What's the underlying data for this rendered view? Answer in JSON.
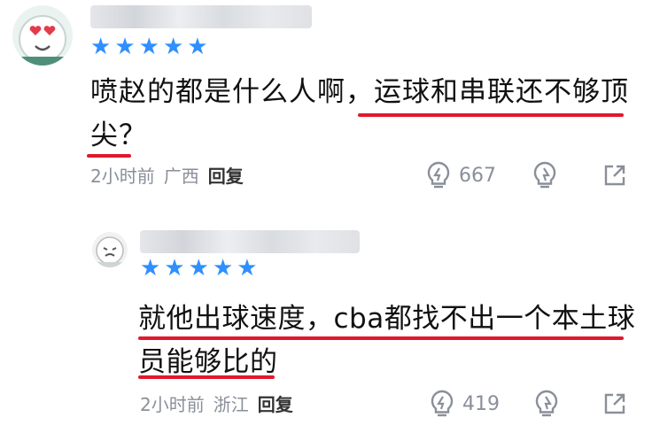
{
  "comments": [
    {
      "rating": 5,
      "text_line1": "喷赵的都是什么人啊，运球和串联还不够顶",
      "text_line2": "尖？",
      "time": "2小时前",
      "location": "广西",
      "reply_label": "回复",
      "likes": "667"
    },
    {
      "rating": 5,
      "text_line1": "就他出球速度，cba都找不出一个本土球",
      "text_line2": "员能够比的",
      "time": "2小时前",
      "location": "浙江",
      "reply_label": "回复",
      "likes": "419"
    }
  ],
  "icons": {
    "star": "star-icon",
    "like": "lightbulb-like-icon",
    "dislike": "lightbulb-dislike-icon",
    "share": "share-icon"
  },
  "colors": {
    "star": "#2f8fff",
    "underline": "#e0192e",
    "meta_text": "#8a8f99"
  }
}
